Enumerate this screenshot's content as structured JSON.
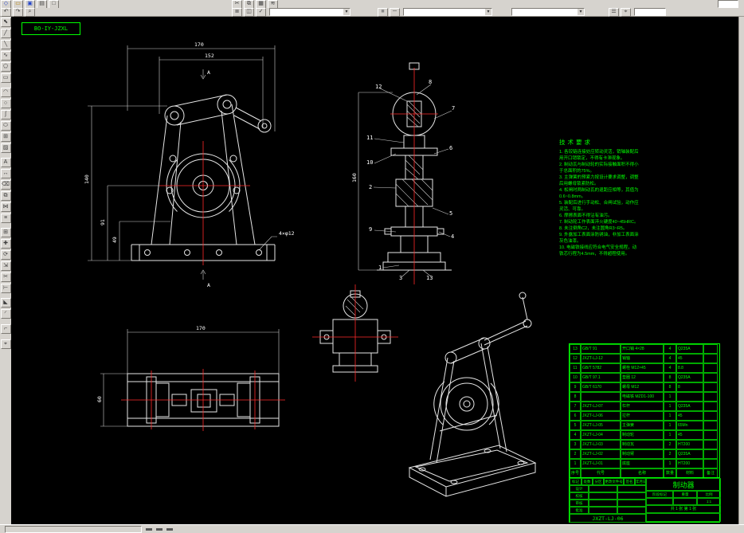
{
  "app": {
    "chrome_bg": "#d6d3ce",
    "canvas_bg": "#000000",
    "green": "#00ff00",
    "white": "#ffffff",
    "red": "#ff2a2a"
  },
  "toolbar_top": {
    "row1_left": [
      {
        "name": "qnew-icon",
        "glyph": "◇",
        "color": "#2244cc"
      },
      {
        "name": "open-icon",
        "glyph": "▭",
        "color": "#b8860b"
      },
      {
        "name": "save-icon",
        "glyph": "▣",
        "color": "#2244cc"
      },
      {
        "name": "print-icon",
        "glyph": "▤",
        "color": "#444444"
      },
      {
        "name": "preview-icon",
        "glyph": "□",
        "color": "#444444"
      }
    ],
    "row1_mid": [
      {
        "name": "cut-icon",
        "glyph": "✂"
      },
      {
        "name": "copy-clip-icon",
        "glyph": "⧉"
      },
      {
        "name": "paste-icon",
        "glyph": "▦"
      },
      {
        "name": "match-prop-icon",
        "glyph": "≋"
      }
    ],
    "row2_left": [
      {
        "name": "undo-icon",
        "glyph": "↶"
      },
      {
        "name": "redo-icon",
        "glyph": "↷"
      },
      {
        "name": "find-icon",
        "glyph": "⌕"
      }
    ],
    "row2_mid": [
      {
        "name": "layer-manager-icon",
        "glyph": "≣"
      },
      {
        "name": "layer-state-icon",
        "glyph": "◫"
      },
      {
        "name": "make-current-icon",
        "glyph": "✓"
      }
    ],
    "row2_mid2": [
      {
        "name": "color-control-icon",
        "glyph": "■",
        "color": "#888888"
      },
      {
        "name": "linetype-control-icon",
        "glyph": "─"
      }
    ],
    "row2_right": [
      {
        "name": "properties-icon",
        "glyph": "☰"
      },
      {
        "name": "osnap-icon",
        "glyph": "⌖"
      }
    ],
    "combos": {
      "layer_value": "",
      "color_value": "",
      "linetype_value": "",
      "style_value": ""
    }
  },
  "toolbar_left": {
    "icons": [
      {
        "name": "select-icon",
        "glyph": "⬉"
      },
      {
        "name": "line-icon",
        "glyph": "╱"
      },
      {
        "name": "xline-icon",
        "glyph": "╲"
      },
      {
        "name": "polyline-icon",
        "glyph": "∿"
      },
      {
        "name": "polygon-icon",
        "glyph": "⬠"
      },
      {
        "name": "rectangle-icon",
        "glyph": "▭"
      },
      {
        "name": "arc-icon",
        "glyph": "◠"
      },
      {
        "name": "circle-icon",
        "glyph": "○"
      },
      {
        "name": "spline-icon",
        "glyph": "ʃ"
      },
      {
        "name": "ellipse-icon",
        "glyph": "⬭"
      },
      {
        "name": "insert-block-icon",
        "glyph": "⊞"
      },
      {
        "name": "hatch-icon",
        "glyph": "▨"
      },
      {
        "name": "text-icon",
        "glyph": "A"
      },
      {
        "name": "dimension-icon",
        "glyph": "↔"
      },
      {
        "name": "erase-icon",
        "glyph": "⌫"
      },
      {
        "name": "copy-icon",
        "glyph": "⧉"
      },
      {
        "name": "mirror-icon",
        "glyph": "⋈"
      },
      {
        "name": "offset-icon",
        "glyph": "≡"
      },
      {
        "name": "array-icon",
        "glyph": "⊞"
      },
      {
        "name": "move-icon",
        "glyph": "✚"
      },
      {
        "name": "rotate-icon",
        "glyph": "⟳"
      },
      {
        "name": "scale-icon",
        "glyph": "⇲"
      },
      {
        "name": "trim-icon",
        "glyph": "✂"
      },
      {
        "name": "extend-icon",
        "glyph": "⊢"
      },
      {
        "name": "chamfer-icon",
        "glyph": "◣"
      },
      {
        "name": "fillet-icon",
        "glyph": "◜"
      }
    ],
    "bottom_icons": [
      {
        "name": "ucs-icon",
        "glyph": "⌐"
      },
      {
        "name": "distance-icon",
        "glyph": "⌖"
      }
    ]
  },
  "drawing": {
    "corner_label": "BO-IY-JZXL",
    "front_view": {
      "dim_170": "170",
      "dim_152": "152",
      "dim_140": "140",
      "dim_91": "91",
      "dim_49": "49",
      "hole_note": "4×φ12",
      "section_letter": "A"
    },
    "side_view": {
      "dim_160": "160",
      "balloons": [
        "1",
        "2",
        "3",
        "4",
        "5",
        "6",
        "7",
        "8",
        "9",
        "10",
        "11",
        "12",
        "13"
      ]
    },
    "bottom_view": {
      "dim_170": "170",
      "dim_60": "60"
    }
  },
  "notes": {
    "title": "技术要求",
    "lines": [
      "1. 各铰链连接处应转动灵活，销轴装配后",
      "   用开口销锁定，不得有卡滞现象。",
      "2. 制动瓦与制动轮的实际接触面积不得小",
      "   于总面积的75%。",
      "3. 主弹簧的预紧力按设计要求调整，调整",
      "   后用螺母锁紧防松。",
      "4. 松闸时两制动瓦的退距应相等，其值为",
      "   0.6~0.8mm。",
      "5. 装配后进行手动松、合闸试验，动作应",
      "   灵活、可靠。",
      "6. 摩擦表面不得沾有油污。",
      "7. 制动轮工作表面淬火硬度40~45HRC。",
      "8. 未注倒角C2，未注圆角R3~R5。",
      "9. 外露加工表面涂防锈油，非加工表面涂",
      "   灰色油漆。",
      "10. 电磁铁接线应符合电气安全规程，动",
      "    铁芯行程为4.5mm，不得超程使用。"
    ]
  },
  "parts_table": {
    "headers": [
      "序号",
      "代号",
      "名称",
      "数量",
      "材料",
      "备注"
    ],
    "rows": [
      [
        "13",
        "GB/T 91",
        "开口销 4×28",
        "4",
        "Q235A",
        ""
      ],
      [
        "12",
        "JXZT-LJ-12",
        "销轴",
        "4",
        "45",
        ""
      ],
      [
        "11",
        "GB/T 5782",
        "螺栓 M12×45",
        "4",
        "8.8",
        ""
      ],
      [
        "10",
        "GB/T 97.1",
        "垫圈 12",
        "8",
        "Q235A",
        ""
      ],
      [
        "9",
        "GB/T 6170",
        "螺母 M12",
        "8",
        "8",
        ""
      ],
      [
        "8",
        "",
        "电磁铁 MZD1-100",
        "1",
        "",
        ""
      ],
      [
        "7",
        "JXZT-LJ-07",
        "杠杆",
        "1",
        "Q235A",
        ""
      ],
      [
        "6",
        "JXZT-LJ-06",
        "拉杆",
        "1",
        "45",
        ""
      ],
      [
        "5",
        "JXZT-LJ-05",
        "主弹簧",
        "1",
        "65Mn",
        ""
      ],
      [
        "4",
        "JXZT-LJ-04",
        "制动轮",
        "1",
        "45",
        ""
      ],
      [
        "3",
        "JXZT-LJ-03",
        "制动瓦",
        "2",
        "HT200",
        ""
      ],
      [
        "2",
        "JXZT-LJ-02",
        "制动臂",
        "2",
        "Q235A",
        ""
      ],
      [
        "1",
        "JXZT-LJ-01",
        "底座",
        "1",
        "HT200",
        ""
      ]
    ]
  },
  "title_block": {
    "product_name": "制动器",
    "drawing_no": "JXZT-LJ-06",
    "left_header": [
      "标记",
      "处数",
      "分区",
      "更改文件号",
      "签名",
      "年月日"
    ],
    "sign_rows": [
      "设计",
      "校核",
      "审核",
      "批准"
    ],
    "stage_label": "阶段标记",
    "weight_label": "重量",
    "scale_label": "比例",
    "scale_value": "1:1",
    "sheet_info": "共 1 张  第 1 张"
  }
}
